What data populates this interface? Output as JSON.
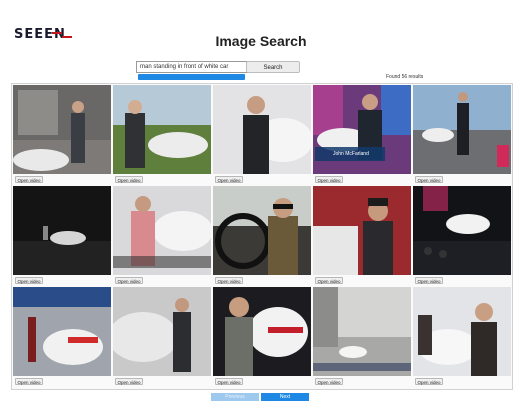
{
  "brand": {
    "logo_text": "SEEEN"
  },
  "title": "Image Search",
  "search": {
    "value": "man standing in front of white car",
    "button_label": "Search"
  },
  "results_text": "Found 56 results",
  "colors": {
    "accent": "#1e88e5",
    "accent_disabled": "#9ec9ef",
    "logo_red": "#c0181c"
  },
  "results": [
    {
      "button_label": "Open video",
      "caption": "",
      "scene": "garage-gray"
    },
    {
      "button_label": "Open video",
      "caption": "",
      "scene": "outdoor-green"
    },
    {
      "button_label": "Open video",
      "caption": "",
      "scene": "studio-white"
    },
    {
      "button_label": "Open video",
      "caption": "John McFarland",
      "scene": "showroom-purple"
    },
    {
      "button_label": "Open video",
      "caption": "",
      "scene": "runway-blue"
    },
    {
      "button_label": "Open video",
      "caption": "",
      "scene": "dark-stage"
    },
    {
      "button_label": "Open video",
      "caption": "",
      "scene": "interview-pink"
    },
    {
      "button_label": "Open video",
      "caption": "",
      "scene": "car-interior"
    },
    {
      "button_label": "Open video",
      "caption": "",
      "scene": "garage-red"
    },
    {
      "button_label": "Open video",
      "caption": "",
      "scene": "auto-show-dark"
    },
    {
      "button_label": "Open video",
      "caption": "",
      "scene": "race-pit"
    },
    {
      "button_label": "Open video",
      "caption": "",
      "scene": "smoke-track"
    },
    {
      "button_label": "Open video",
      "caption": "",
      "scene": "nismo-car"
    },
    {
      "button_label": "Open video",
      "caption": "",
      "scene": "city-street"
    },
    {
      "button_label": "Open video",
      "caption": "",
      "scene": "showroom-woman"
    }
  ],
  "pager": {
    "prev_label": "Previous",
    "next_label": "Next"
  }
}
